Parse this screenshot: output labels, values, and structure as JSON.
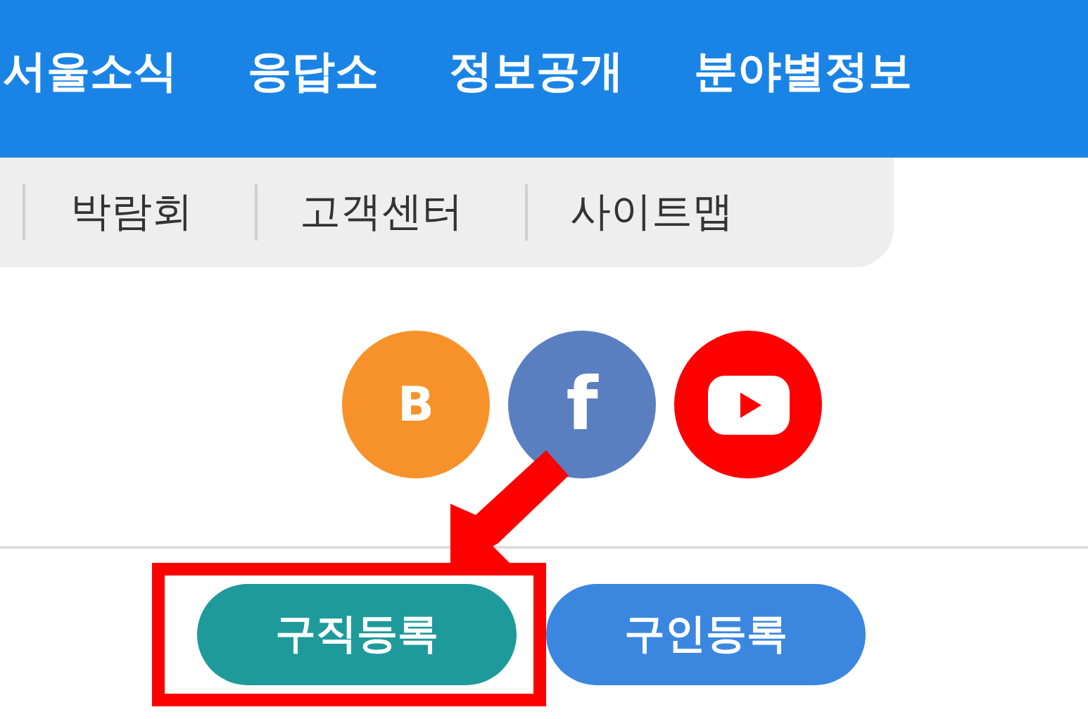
{
  "main_nav": {
    "items": [
      "서울소식",
      "응답소",
      "정보공개",
      "분야별정보"
    ]
  },
  "utility_menu": {
    "items": [
      "박람회",
      "고객센터",
      "사이트맵"
    ]
  },
  "social_links": [
    {
      "kind": "blog",
      "label": "B",
      "color": "#f7922a"
    },
    {
      "kind": "facebook",
      "label": "f",
      "color": "#5a7fc0"
    },
    {
      "kind": "youtube",
      "color": "#ff0000"
    }
  ],
  "actions": [
    {
      "label": "구직등록",
      "highlighted": true,
      "color": "#1e9a9a"
    },
    {
      "label": "구인등록",
      "highlighted": false,
      "color": "#3b87e0"
    }
  ]
}
